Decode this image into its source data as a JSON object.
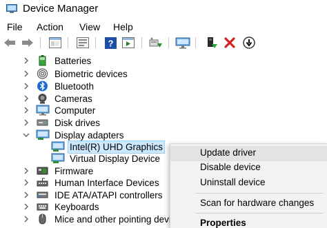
{
  "window": {
    "title": "Device Manager"
  },
  "menu": {
    "items": [
      "File",
      "Action",
      "View",
      "Help"
    ]
  },
  "toolbar": {
    "buttons": [
      "back-icon",
      "forward-icon",
      "show-hide-console-tree-icon",
      "properties-icon",
      "help-icon",
      "action-pane-icon",
      "update-driver-icon",
      "scan-hardware-icon",
      "enable-device-icon",
      "uninstall-device-icon",
      "disable-device-icon"
    ]
  },
  "tree": {
    "items": [
      {
        "label": "Batteries",
        "expanded": false,
        "level": 0,
        "icon": "battery-icon"
      },
      {
        "label": "Biometric devices",
        "expanded": false,
        "level": 0,
        "icon": "fingerprint-icon"
      },
      {
        "label": "Bluetooth",
        "expanded": false,
        "level": 0,
        "icon": "bluetooth-icon"
      },
      {
        "label": "Cameras",
        "expanded": false,
        "level": 0,
        "icon": "camera-icon"
      },
      {
        "label": "Computer",
        "expanded": false,
        "level": 0,
        "icon": "computer-icon"
      },
      {
        "label": "Disk drives",
        "expanded": false,
        "level": 0,
        "icon": "disk-drive-icon"
      },
      {
        "label": "Display adapters",
        "expanded": true,
        "level": 0,
        "icon": "display-adapter-icon"
      },
      {
        "label": "Intel(R) UHD Graphics",
        "level": 1,
        "selected": true,
        "icon": "display-adapter-icon"
      },
      {
        "label": "Virtual Display Device",
        "level": 1,
        "icon": "display-adapter-icon"
      },
      {
        "label": "Firmware",
        "expanded": false,
        "level": 0,
        "icon": "firmware-icon"
      },
      {
        "label": "Human Interface Devices",
        "expanded": false,
        "level": 0,
        "icon": "hid-icon"
      },
      {
        "label": "IDE ATA/ATAPI controllers",
        "expanded": false,
        "level": 0,
        "icon": "ide-controller-icon"
      },
      {
        "label": "Keyboards",
        "expanded": false,
        "level": 0,
        "icon": "keyboard-icon"
      },
      {
        "label": "Mice and other pointing devices",
        "expanded": false,
        "level": 0,
        "icon": "mouse-icon"
      }
    ]
  },
  "context_menu": {
    "items": [
      {
        "label": "Update driver",
        "hover": true
      },
      {
        "label": "Disable device"
      },
      {
        "label": "Uninstall device"
      },
      {
        "label": "Scan for hardware changes"
      },
      {
        "label": "Properties",
        "bold": true
      }
    ]
  }
}
